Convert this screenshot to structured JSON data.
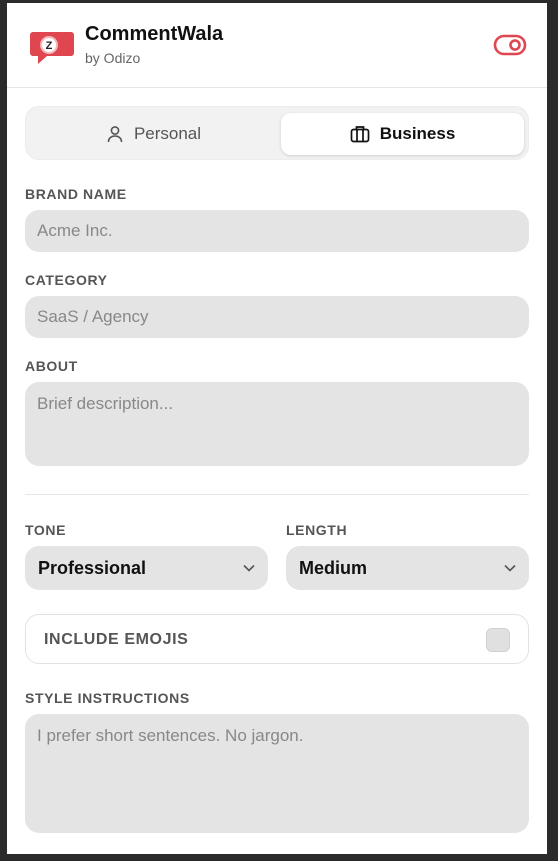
{
  "header": {
    "title": "CommentWala",
    "subtitle": "by Odizo",
    "logo_icon": "speech-bubble-logo-icon",
    "brand_color": "#e0464f",
    "toggle_icon": "toggle-switch-icon"
  },
  "tabs": [
    {
      "label": "Personal",
      "icon": "person-icon",
      "active": false
    },
    {
      "label": "Business",
      "icon": "briefcase-icon",
      "active": true
    }
  ],
  "form": {
    "brand_name": {
      "label": "BRAND NAME",
      "placeholder": "Acme Inc.",
      "value": ""
    },
    "category": {
      "label": "CATEGORY",
      "placeholder": "SaaS / Agency",
      "value": ""
    },
    "about": {
      "label": "ABOUT",
      "placeholder": "Brief description...",
      "value": ""
    },
    "tone": {
      "label": "TONE",
      "selected": "Professional"
    },
    "length": {
      "label": "LENGTH",
      "selected": "Medium"
    },
    "include_emojis": {
      "label": "INCLUDE EMOJIS",
      "checked": false
    },
    "style_instructions": {
      "label": "STYLE INSTRUCTIONS",
      "placeholder": "I prefer short sentences. No jargon.",
      "value": ""
    }
  }
}
